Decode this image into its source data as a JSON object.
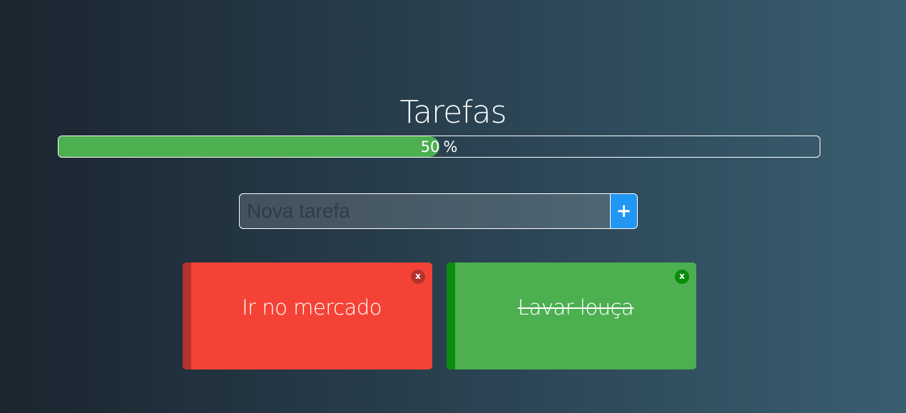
{
  "header": {
    "title": "Tarefas"
  },
  "progress": {
    "value": 50,
    "unit": "%",
    "fill_color": "#4caf50"
  },
  "new_task": {
    "placeholder": "Nova tarefa",
    "value": "",
    "add_label": "+",
    "add_color": "#2196f3"
  },
  "tasks": [
    {
      "text": "Ir no mercado",
      "done": false,
      "color": "#f44336",
      "close_label": "x"
    },
    {
      "text": "Lavar louça",
      "done": true,
      "color": "#4caf50",
      "close_label": "x"
    }
  ]
}
